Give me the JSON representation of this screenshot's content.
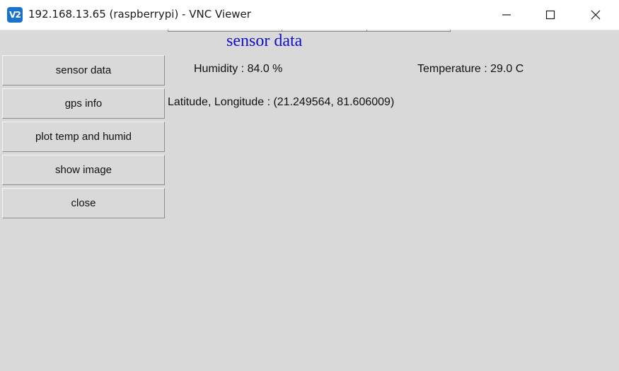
{
  "window": {
    "app_icon_text": "V2",
    "title": "192.168.13.65 (raspberrypi) - VNC Viewer",
    "icons": [
      "minimize-icon",
      "maximize-icon",
      "close-icon"
    ]
  },
  "main": {
    "heading": "sensor data",
    "heading_color": "#1010c0",
    "humidity_text": "Humidity : 84.0 %",
    "temperature_text": "Temperature : 29.0 C",
    "latlon_text": "Latitude, Longitude : (21.249564, 81.606009)"
  },
  "sidebar": {
    "buttons": [
      {
        "label": "sensor data"
      },
      {
        "label": "gps info"
      },
      {
        "label": "plot temp and humid"
      },
      {
        "label": "show image"
      },
      {
        "label": "close"
      }
    ]
  }
}
